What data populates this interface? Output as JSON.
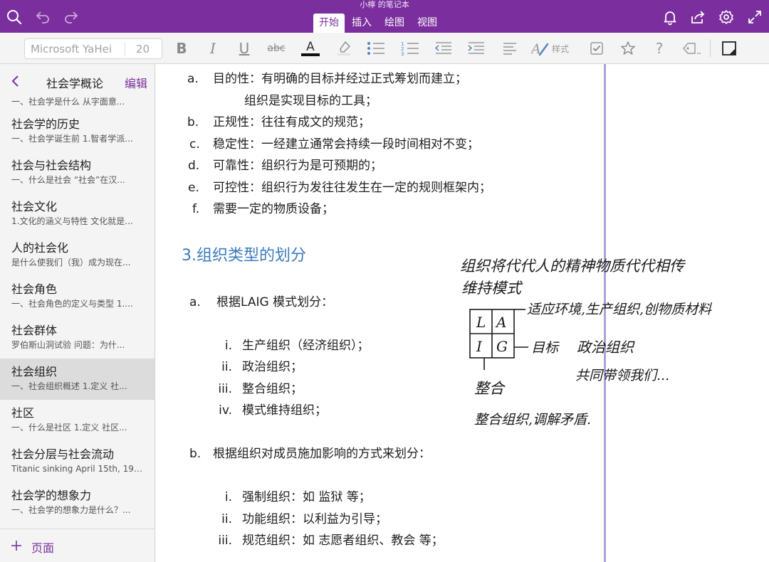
{
  "app": {
    "notebook_title": "小檸 的笔记本",
    "accent_color": "#7b2f9e"
  },
  "topbar": {
    "left_icons": [
      "search-icon",
      "undo-icon",
      "redo-icon"
    ],
    "right_icons": [
      "bell-icon",
      "share-icon",
      "gear-icon",
      "expand-icon"
    ],
    "tabs": [
      {
        "label": "开始",
        "active": true
      },
      {
        "label": "插入",
        "active": false
      },
      {
        "label": "绘图",
        "active": false
      },
      {
        "label": "视图",
        "active": false
      }
    ]
  },
  "toolbar": {
    "font_name": "Microsoft YaHei",
    "font_size": "20",
    "bold": "B",
    "italic": "I",
    "underline": "U",
    "strikethrough": "abc",
    "font_color": "A",
    "style_label": "样式",
    "help": "?"
  },
  "sidebar": {
    "section_title": "社会学概论",
    "edit_label": "编辑",
    "add_page_label": "页面",
    "pages": [
      {
        "title": "",
        "subtitle": "一、社会学是什么 从字面意..."
      },
      {
        "title": "社会学的历史",
        "subtitle": "一、社会学诞生前 1.智者学派..."
      },
      {
        "title": "社会与社会结构",
        "subtitle": "一、什么是社会 “社会”在汉..."
      },
      {
        "title": "社会文化",
        "subtitle": "1.文化的涵义与特性 文化就是..."
      },
      {
        "title": "人的社会化",
        "subtitle": "是什么使我们（我）成为现在..."
      },
      {
        "title": "社会角色",
        "subtitle": "一、社会角色的定义与类型 1...."
      },
      {
        "title": "社会群体",
        "subtitle": "罗伯斯山洞试验 问题：为什..."
      },
      {
        "title": "社会组织",
        "subtitle": "一、社会组织概述 1.定义 社...",
        "selected": true
      },
      {
        "title": "社区",
        "subtitle": "一、什么是社区 1.定义 社区..."
      },
      {
        "title": "社会分层与社会流动",
        "subtitle": "Titanic sinking April 15th, 191..."
      },
      {
        "title": "社会学的想象力",
        "subtitle": "一、社会学的想象力是什么？..."
      }
    ]
  },
  "note": {
    "characteristics": [
      {
        "marker": "a.",
        "text": "目的性：有明确的目标并经过正式筹划而建立；"
      },
      {
        "marker": "",
        "text": "组织是实现目标的工具；"
      },
      {
        "marker": "b.",
        "text": "正规性：往往有成文的规范；"
      },
      {
        "marker": "c.",
        "text": "稳定性：一经建立通常会持续一段时间相对不变；"
      },
      {
        "marker": "d.",
        "text": "可靠性：组织行为是可预期的；"
      },
      {
        "marker": "e.",
        "text": "可控性：组织行为发往往发生在一定的规则框架内；"
      },
      {
        "marker": "f.",
        "text": "需要一定的物质设备；"
      }
    ],
    "heading": "3.组织类型的划分",
    "section_a": {
      "marker": "a.",
      "text": "根据LAIG 模式划分："
    },
    "section_a_items": [
      {
        "marker": "i.",
        "text": "生产组织（经济组织）；"
      },
      {
        "marker": "ii.",
        "text": "政治组织；"
      },
      {
        "marker": "iii.",
        "text": "整合组织；"
      },
      {
        "marker": "iv.",
        "text": "模式维持组织；"
      }
    ],
    "section_b": {
      "marker": "b.",
      "text": "根据组织对成员施加影响的方式来划分："
    },
    "section_b_items": [
      {
        "marker": "i.",
        "text": "强制组织：如 监狱 等；"
      },
      {
        "marker": "ii.",
        "text": "功能组织：以利益为引导；"
      },
      {
        "marker": "iii.",
        "text": "规范组织：如 志愿者组织、教会 等；"
      }
    ],
    "handwriting": {
      "line1": "组织将代代人的精神物质代代相传",
      "line2": "维持模式",
      "grid": [
        "L",
        "A",
        "I",
        "G"
      ],
      "a_note": "适应环境,生产组织,创物质材料",
      "g_note": "目标",
      "g_note2": "政治组织",
      "g_note3": "共同带领我们...",
      "i_note": "整合",
      "i_note2": "整合组织,调解矛盾."
    }
  }
}
